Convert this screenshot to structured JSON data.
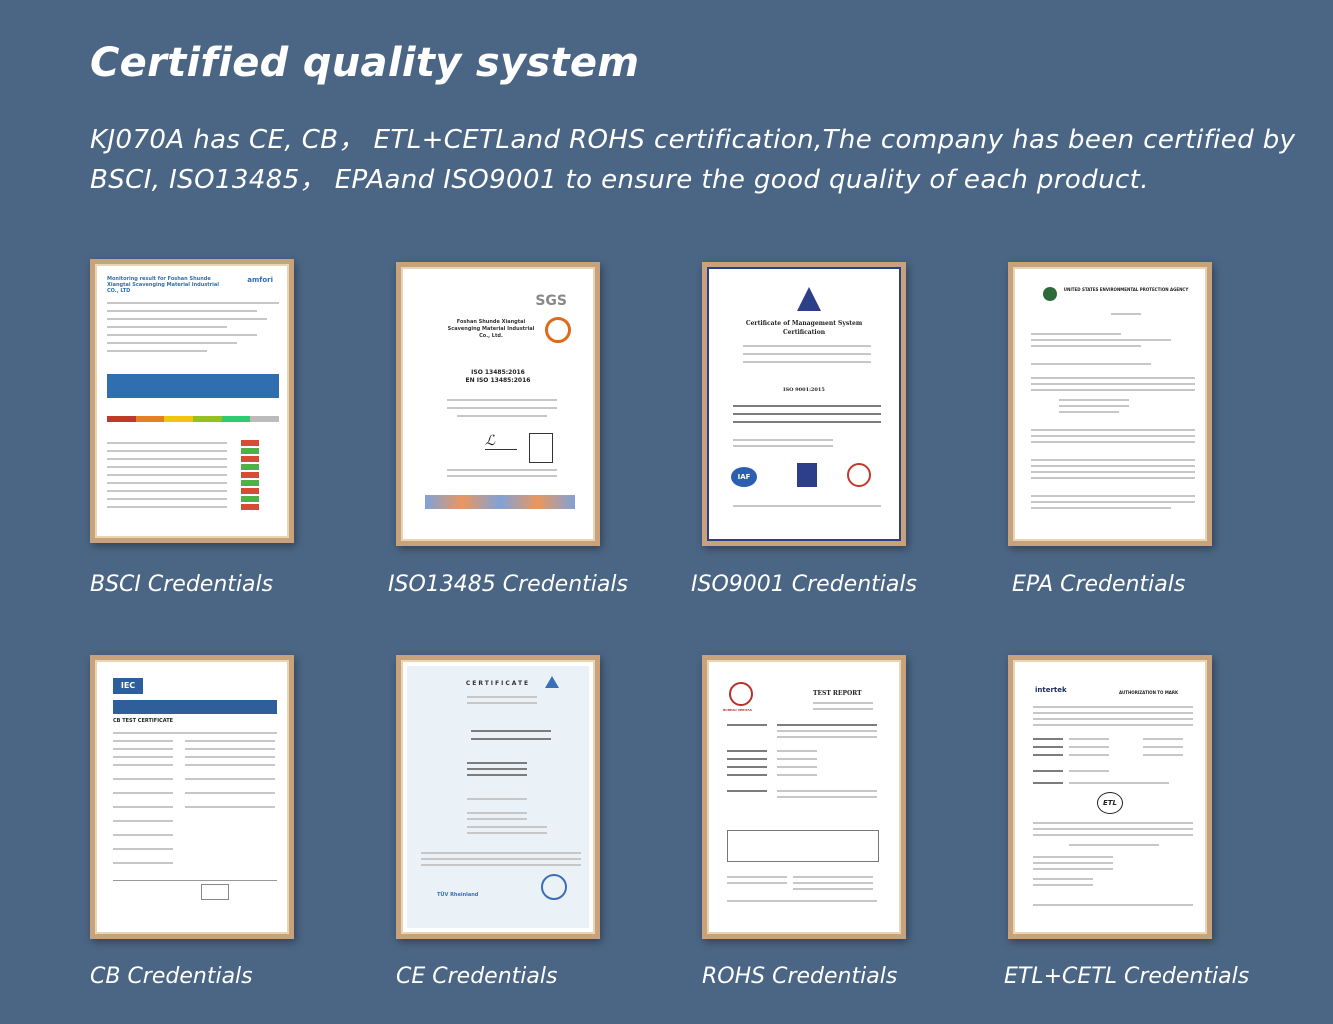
{
  "header": {
    "title": "Certified quality system",
    "description_line1": "KJ070A has CE, CB， ETL+CETLand ROHS certification,The company has been certified by",
    "description_line2": "BSCI, ISO13485， EPAand ISO9001 to ensure the good quality of each product."
  },
  "certificates": [
    {
      "caption": "BSCI Credentials",
      "doc_heading": "Monitoring result for Foshan Shunde Xiangtai Scavenging Material Industrial CO., LTD",
      "logo_text": "amfori",
      "accent": "#2f6fb0"
    },
    {
      "caption": "ISO13485 Credentials",
      "doc_heading": "Foshan Shunde Xiangtai Scavenging Material Industrial Co., Ltd.",
      "logo_text": "SGS",
      "standard_text": "ISO 13485:2016",
      "standard_text2": "EN ISO 13485:2016",
      "accent": "#e06a1a"
    },
    {
      "caption": "ISO9001 Credentials",
      "doc_heading": "Certificate of Management System Certification",
      "standard_text": "ISO 9001:2015",
      "logo_text": "IAF",
      "accent": "#2d3f8a"
    },
    {
      "caption": "EPA Credentials",
      "doc_heading": "UNITED STATES ENVIRONMENTAL PROTECTION AGENCY",
      "accent": "#2d6a3a"
    },
    {
      "caption": "CB Credentials",
      "doc_heading": "CB TEST CERTIFICATE",
      "logo_text": "IEC",
      "accent": "#2f5f9a"
    },
    {
      "caption": "CE Credentials",
      "doc_heading": "CERTIFICATE",
      "logo_text": "TÜV Rheinland",
      "accent": "#3b6fb6"
    },
    {
      "caption": "ROHS Credentials",
      "doc_heading": "TEST REPORT",
      "logo_text": "BUREAU VERITAS",
      "accent": "#b5322a"
    },
    {
      "caption": "ETL+CETL Credentials",
      "doc_heading": "AUTHORIZATION TO MARK",
      "logo_text": "intertek",
      "mark_text": "ETL",
      "accent": "#1c2a5a"
    }
  ]
}
